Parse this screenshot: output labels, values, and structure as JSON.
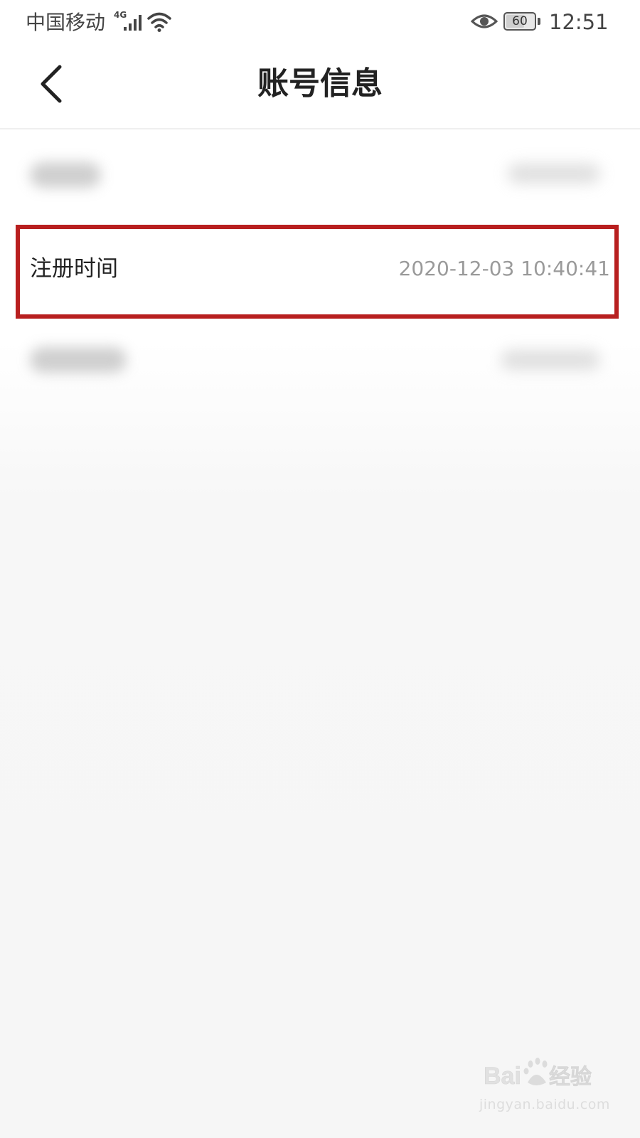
{
  "status_bar": {
    "carrier": "中国移动",
    "network_type": "4G",
    "battery_level": "60",
    "time": "12:51",
    "icons": [
      "signal-icon",
      "wifi-icon",
      "eye-icon",
      "battery-icon"
    ]
  },
  "header": {
    "title": "账号信息",
    "back_icon": "back-chevron-icon"
  },
  "rows": [
    {
      "label": "",
      "value": "",
      "blurred": true
    },
    {
      "label": "注册时间",
      "value": "2020-12-03 10:40:41",
      "blurred": false,
      "highlighted": true
    },
    {
      "label": "",
      "value": "",
      "blurred": true
    }
  ],
  "highlight_color": "#b81f1f",
  "watermark": {
    "logo_text": "Baidu经验",
    "url": "jingyan.baidu.com"
  }
}
